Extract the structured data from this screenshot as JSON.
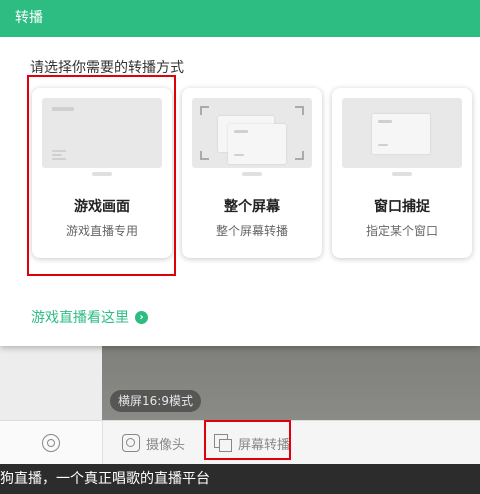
{
  "dialog": {
    "title": "转播",
    "prompt": "请选择你需要的转播方式",
    "options": [
      {
        "title": "游戏画面",
        "subtitle": "游戏直播专用"
      },
      {
        "title": "整个屏幕",
        "subtitle": "整个屏幕转播"
      },
      {
        "title": "窗口捕捉",
        "subtitle": "指定某个窗口"
      }
    ],
    "help_link": "游戏直播看这里",
    "accent_color": "#2dbd83"
  },
  "preview": {
    "ratio_label": "横屏16:9模式"
  },
  "toolbar": {
    "camera_label": "摄像头",
    "screen_label": "屏幕转播"
  },
  "status_bar": {
    "text": "狗直播，一个真正唱歌的直播平台"
  },
  "highlight_color": "#e0000a"
}
